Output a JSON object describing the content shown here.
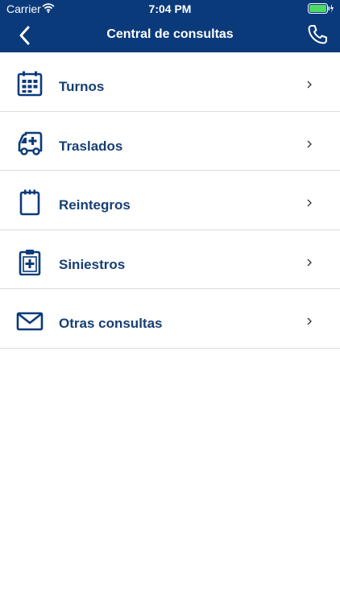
{
  "status_bar": {
    "carrier": "Carrier",
    "time": "7:04 PM"
  },
  "nav": {
    "title": "Central de consultas"
  },
  "menu": {
    "items": [
      {
        "label": "Turnos",
        "icon": "calendar-icon"
      },
      {
        "label": "Traslados",
        "icon": "ambulance-icon"
      },
      {
        "label": "Reintegros",
        "icon": "notepad-icon"
      },
      {
        "label": "Siniestros",
        "icon": "medical-clipboard-icon"
      },
      {
        "label": "Otras consultas",
        "icon": "envelope-icon"
      }
    ]
  },
  "colors": {
    "header": "#0b3a7a",
    "label": "#173f73",
    "divider": "#dcdcdc",
    "icon": "#0b3a7a"
  }
}
